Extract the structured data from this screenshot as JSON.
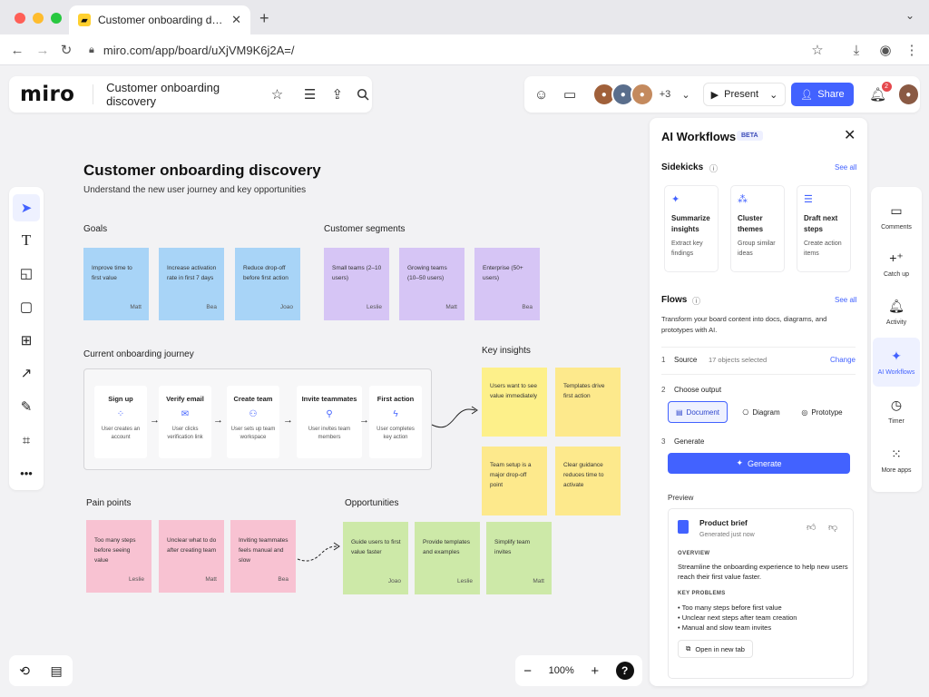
{
  "browser": {
    "tab_title": "Customer onboarding discovery",
    "url": "miro.com/app/board/uXjVM9K6j2A=/",
    "window_dots": [
      "#ff5f57",
      "#febc2e",
      "#28c840"
    ]
  },
  "topbar": {
    "logo": "miro",
    "board_title": "Customer onboarding discovery",
    "collaborators_extra": "+3",
    "present_label": "Present",
    "share_label": "Share",
    "notification_count": "2"
  },
  "canvas": {
    "title": "Customer onboarding discovery",
    "subtitle": "Understand the new user journey and key opportunities",
    "goals": {
      "label": "Goals",
      "notes": [
        {
          "text": "Improve time to first value",
          "author": "Matt"
        },
        {
          "text": "Increase activation rate in first 7 days",
          "author": "Bea"
        },
        {
          "text": "Reduce drop-off before first action",
          "author": "Joao"
        }
      ]
    },
    "segments": {
      "label": "Customer segments",
      "notes": [
        {
          "text": "Small teams (2–10 users)",
          "author": "Leslie"
        },
        {
          "text": "Growing teams (10–50 users)",
          "author": "Matt"
        },
        {
          "text": "Enterprise (50+ users)",
          "author": "Bea"
        }
      ]
    },
    "journey": {
      "label": "Current onboarding journey",
      "steps": [
        {
          "title": "Sign up",
          "desc": "User creates an account",
          "icon": "apps-icon"
        },
        {
          "title": "Verify email",
          "desc": "User clicks verification link",
          "icon": "mail-icon"
        },
        {
          "title": "Create team",
          "desc": "User sets up team workspace",
          "icon": "users-icon"
        },
        {
          "title": "Invite teammates",
          "desc": "User invites team members",
          "icon": "user-plus-icon"
        },
        {
          "title": "First action",
          "desc": "User completes key action",
          "icon": "bolt-icon"
        }
      ]
    },
    "insights": {
      "label": "Key insights",
      "notes": [
        {
          "text": "Users want to see value immediately"
        },
        {
          "text": "Templates drive first action"
        },
        {
          "text": "Team setup is a major drop-off point"
        },
        {
          "text": "Clear guidance reduces time to activate"
        }
      ]
    },
    "pain_points": {
      "label": "Pain points",
      "notes": [
        {
          "text": "Too many steps before seeing value",
          "author": "Leslie"
        },
        {
          "text": "Unclear what to do after creating team",
          "author": "Matt"
        },
        {
          "text": "Inviting teammates feels manual and slow",
          "author": "Bea"
        }
      ]
    },
    "opportunities": {
      "label": "Opportunities",
      "notes": [
        {
          "text": "Guide users to first value faster",
          "author": "Joao"
        },
        {
          "text": "Provide templates and examples",
          "author": "Leslie"
        },
        {
          "text": "Simplify team invites",
          "author": "Matt"
        }
      ]
    }
  },
  "zoom": {
    "level": "100%",
    "minus": "−",
    "plus": "+",
    "help": "?"
  },
  "ai_panel": {
    "title": "AI Workflows",
    "beta": "BETA",
    "sidekicks_label": "Sidekicks",
    "see_all": "See all",
    "sidekicks": [
      {
        "title": "Summarize insights",
        "desc": "Extract key findings",
        "icon": "sparkle-icon"
      },
      {
        "title": "Cluster themes",
        "desc": "Group similar ideas",
        "icon": "cluster-icon"
      },
      {
        "title": "Draft next steps",
        "desc": "Create action items",
        "icon": "list-icon"
      }
    ],
    "flows_label": "Flows",
    "flows_desc": "Transform your board content into docs, diagrams, and prototypes with AI.",
    "source": {
      "num": "1",
      "label": "Source",
      "value": "17 objects selected",
      "action": "Change"
    },
    "output": {
      "num": "2",
      "label": "Choose output",
      "options": [
        "Document",
        "Diagram",
        "Prototype"
      ],
      "selected": "Document"
    },
    "generate": {
      "num": "3",
      "label": "Generate",
      "button": "Generate"
    },
    "preview": {
      "label": "Preview",
      "title": "Product brief",
      "meta": "Generated just now",
      "overview_h": "OVERVIEW",
      "overview": "Streamline the onboarding experience to help new users reach their first value faster.",
      "problems_h": "KEY PROBLEMS",
      "problems": [
        "Too many steps before first value",
        "Unclear next steps after team creation",
        "Manual and slow team invites"
      ],
      "open_label": "Open in new tab"
    }
  },
  "right_rail": [
    {
      "label": "Comments",
      "icon": "comment-icon"
    },
    {
      "label": "Catch up",
      "icon": "catch-up-icon"
    },
    {
      "label": "Activity",
      "icon": "bell-icon"
    },
    {
      "label": "AI Workflows",
      "icon": "sparkle-icon",
      "active": true
    },
    {
      "label": "Timer",
      "icon": "timer-icon"
    },
    {
      "label": "More apps",
      "icon": "grid-icon"
    }
  ],
  "colors": {
    "accent": "#4262ff",
    "sticky_blue": "#a8d4f7",
    "sticky_purple": "#d6c5f5",
    "sticky_yellow": "#fdf08a",
    "sticky_pink": "#f8c2d2",
    "sticky_green": "#cde9a8"
  }
}
